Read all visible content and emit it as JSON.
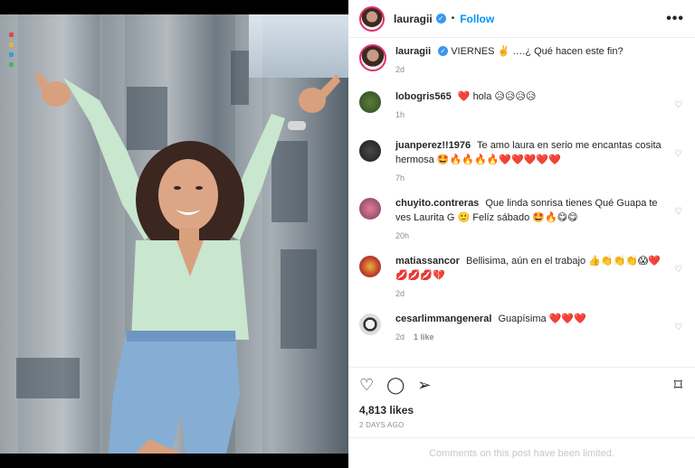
{
  "post": {
    "username": "lauragii",
    "follow_label": "Follow",
    "separator": "•",
    "more_label": "•••"
  },
  "caption": {
    "username": "lauragii",
    "text": "VIERNES ✌️ ….¿ Qué hacen este fin?",
    "time": "2d"
  },
  "comments": [
    {
      "user": "lobogris565",
      "text": "❤️ hola 😥😥😥😥",
      "time": "1h",
      "likes": ""
    },
    {
      "user": "juanperez!!1976",
      "text": "Te amo laura en serio me encantas cosita hermosa 🤩🔥🔥🔥🔥❤️❤️❤️❤️❤️",
      "time": "7h",
      "likes": ""
    },
    {
      "user": "chuyito.contreras",
      "text": "Que linda sonrisa tienes Qué Guapa te ves Laurita G 🙂 Felíz sábado 🤩🔥😋😋",
      "time": "20h",
      "likes": ""
    },
    {
      "user": "matiassancor",
      "text": "Bellisima, aún en el trabajo 👍👏👏👏😱❤️💋💋💋💔",
      "time": "2d",
      "likes": ""
    },
    {
      "user": "cesarlimmangeneral",
      "text": "Guapísima ❤️❤️❤️",
      "time": "2d",
      "likes": "1 like"
    }
  ],
  "actions": {
    "likes": "4,813 likes",
    "ago": "2 DAYS AGO",
    "limited": "Comments on this post have been limited."
  },
  "colors": {
    "accent": "#0095f6",
    "verified": "#3897f0",
    "muted": "#8e8e8e",
    "shirt": "#c9e6cf"
  }
}
